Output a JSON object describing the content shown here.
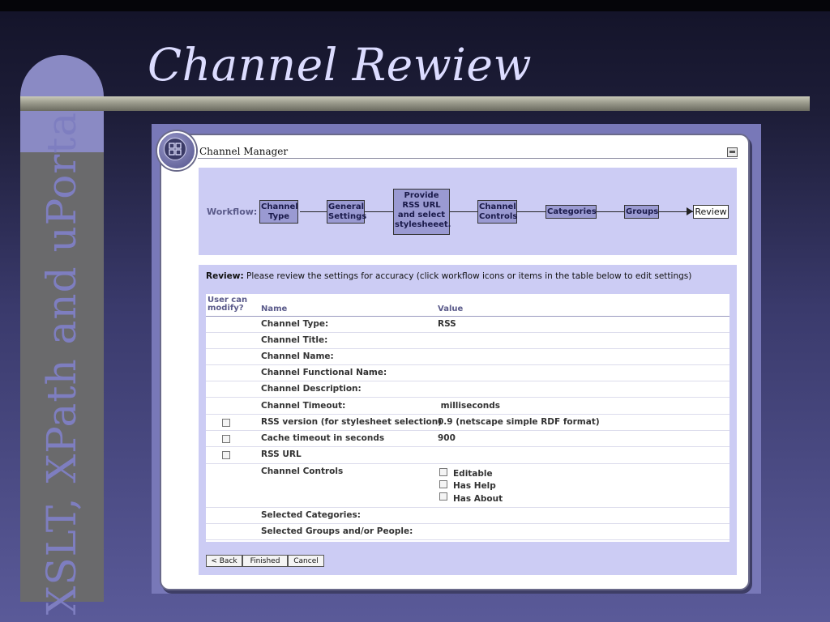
{
  "slide": {
    "title": "Channel Rewiew",
    "sidebar_text": "XSLT, XPath and uPortal"
  },
  "window": {
    "title": "Channel Manager",
    "icons": {
      "orb": "portal-grid-icon",
      "minimize": "minimize-icon"
    }
  },
  "workflow": {
    "label": "Workflow:",
    "steps": [
      {
        "label": "Channel\nType"
      },
      {
        "label": "General\nSettings"
      },
      {
        "label": "Provide\nRSS URL\nand select\nstylesheeet."
      },
      {
        "label": "Channel\nControls"
      },
      {
        "label": "Categories"
      },
      {
        "label": "Groups"
      },
      {
        "label": "Review"
      }
    ]
  },
  "review": {
    "intro_bold": "Review:",
    "intro_text": " Please review the settings for accuracy (click workflow icons or items in the table below to edit settings)",
    "columns": {
      "modify": "User can modify?",
      "name": "Name",
      "value": "Value"
    },
    "rows": [
      {
        "name": "Channel Type:",
        "value": "RSS"
      },
      {
        "name": "Channel Title:",
        "value": ""
      },
      {
        "name": "Channel Name:",
        "value": ""
      },
      {
        "name": "Channel Functional Name:",
        "value": ""
      },
      {
        "name": "Channel Description:",
        "value": ""
      },
      {
        "name": "Channel Timeout:",
        "value": " milliseconds"
      },
      {
        "name": "RSS version (for stylesheet selection)",
        "value": "0.9 (netscape simple RDF format)",
        "checkbox": true
      },
      {
        "name": "Cache timeout in seconds",
        "value": "900",
        "checkbox": true
      },
      {
        "name": "RSS URL",
        "value": "",
        "checkbox": true
      },
      {
        "name": "Channel Controls",
        "value": "",
        "controls": [
          "Editable",
          "Has Help",
          "Has About"
        ]
      },
      {
        "name": "Selected Categories:",
        "value": ""
      },
      {
        "name": "Selected Groups and/or People:",
        "value": ""
      }
    ]
  },
  "buttons": {
    "back": "< Back",
    "finished": "Finished",
    "cancel": "Cancel"
  },
  "colors": {
    "band": "#ccccf4",
    "step": "#9a9ad2",
    "title": "#dcdcff"
  }
}
